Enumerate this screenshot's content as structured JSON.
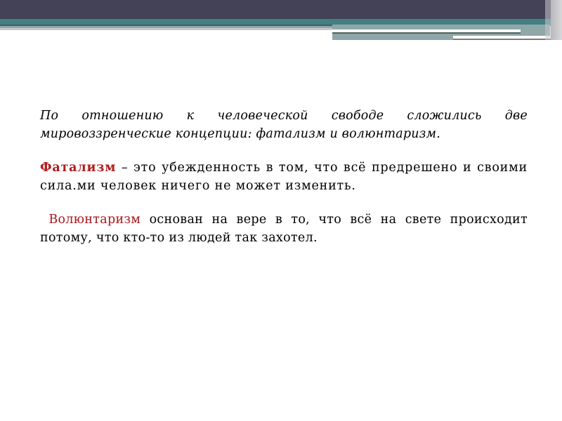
{
  "slide": {
    "paragraphs": [
      {
        "text": "По отношению к человеческой свободе сложились две мировоззренческие концепции: фатализм и волюнтаризм."
      },
      {
        "term": "Фатализм",
        "text": " – это убежденность в том, что всё предрешено и своими сила.ми человек ничего не может изменить."
      },
      {
        "term": "Волюнтаризм",
        "text": " основан на вере в то, что всё на свете происходит потому, что кто-то из людей так захотел."
      }
    ],
    "colors": {
      "header_bar": "#434257",
      "accent_teal": "#447f82",
      "term_red": "#a8151b"
    }
  }
}
